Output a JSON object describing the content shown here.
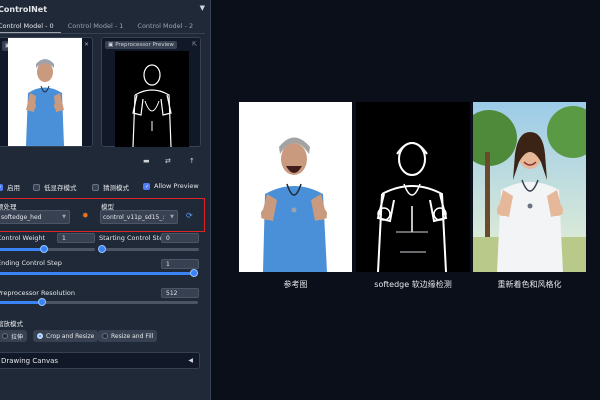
{
  "panel": {
    "title": "ControlNet",
    "tabs": [
      "Control Model - 0",
      "Control Model - 1",
      "Control Model - 2"
    ],
    "image_label": "图像",
    "preview_label": "Preprocessor Preview",
    "checkboxes": [
      {
        "label": "启用",
        "checked": true
      },
      {
        "label": "低显存模式",
        "checked": false
      },
      {
        "label": "猜测模式",
        "checked": false
      },
      {
        "label": "Allow Preview",
        "checked": true
      }
    ],
    "preprocessor_label": "预处理",
    "preprocessor_value": "softedge_hed",
    "model_label": "模型",
    "model_value": "control_v11p_sd15_:",
    "control_weight_label": "Control Weight",
    "control_weight_value": "1",
    "control_weight_fraction": 0.5,
    "starting_step_label": "Starting Control Step",
    "starting_step_value": "0",
    "starting_step_fraction": 0.0,
    "ending_step_label": "Ending Control Step",
    "ending_step_value": "1",
    "ending_step_fraction": 1.0,
    "resolution_label": "Preprocessor Resolution",
    "resolution_value": "512",
    "resolution_fraction": 0.22,
    "resize_mode_label": "缩放模式",
    "resize_options": [
      "拉伸",
      "Crop and Resize",
      "Resize and Fill"
    ],
    "resize_selected": "Crop and Resize",
    "drawing_canvas_label": "Drawing Canvas"
  },
  "gallery": {
    "captions": [
      "参考图",
      "softedge 软边缘检测",
      "重新着色和风格化"
    ]
  },
  "colors": {
    "accent": "#3b82f6",
    "highlight_frame": "#dc2626",
    "panel_bg": "#1f2937",
    "page_bg": "#0b0f19"
  }
}
